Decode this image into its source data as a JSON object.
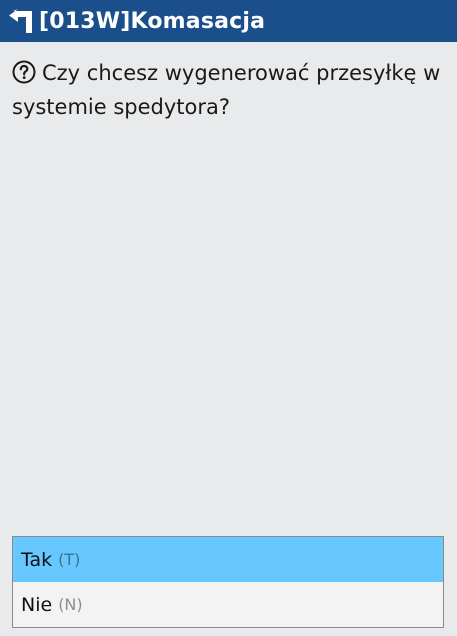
{
  "header": {
    "title": "[013W]Komasacja",
    "back_icon": "return-arrow-icon",
    "background": "#1b4f8c"
  },
  "dialog": {
    "icon": "question-circle-icon",
    "message": "Czy chcesz wygenerować przesyłkę w systemie spedytora?"
  },
  "options": [
    {
      "label": "Tak",
      "key": "(T)",
      "selected": true
    },
    {
      "label": "Nie",
      "key": "(N)",
      "selected": false
    }
  ],
  "colors": {
    "selected_row": "#66c8ff",
    "background": "#e9eaec"
  }
}
